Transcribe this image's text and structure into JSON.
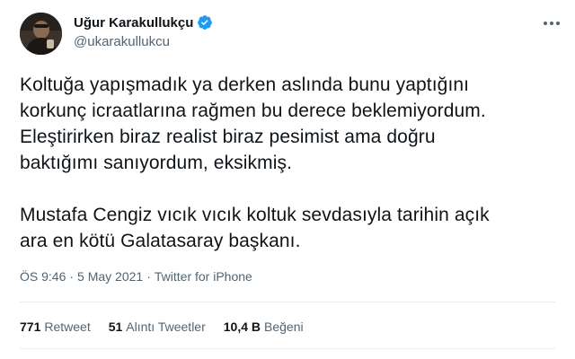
{
  "author": {
    "display_name": "Uğur Karakullukçu",
    "handle": "@ukarakullukcu",
    "verified": true,
    "verified_color": "#1d9bf0",
    "avatar_icon": "user-avatar"
  },
  "tweet": {
    "text": "Koltuğa yapışmadık ya derken aslında bunu yaptığını\nkorkunç icraatlarına rağmen bu derece beklemiyordum.\nEleştirirken biraz realist biraz pesimist ama doğru\nbaktığımı sanıyordum, eksikmiş.\n\nMustafa Cengiz vıcık vıcık koltuk sevdasıyla tarihin açık\nara en kötü Galatasaray başkanı."
  },
  "meta": {
    "time": "ÖS 9:46",
    "separator1": "·",
    "date": "5 May 2021",
    "separator2": "·",
    "source": "Twitter for iPhone"
  },
  "stats": {
    "retweets_count": "771",
    "retweets_label": "Retweet",
    "quotes_count": "51",
    "quotes_label": "Alıntı Tweetler",
    "likes_count": "10,4 B",
    "likes_label": "Beğeni"
  },
  "icons": {
    "more": "more-options-icon",
    "verified": "verified-badge-icon"
  }
}
